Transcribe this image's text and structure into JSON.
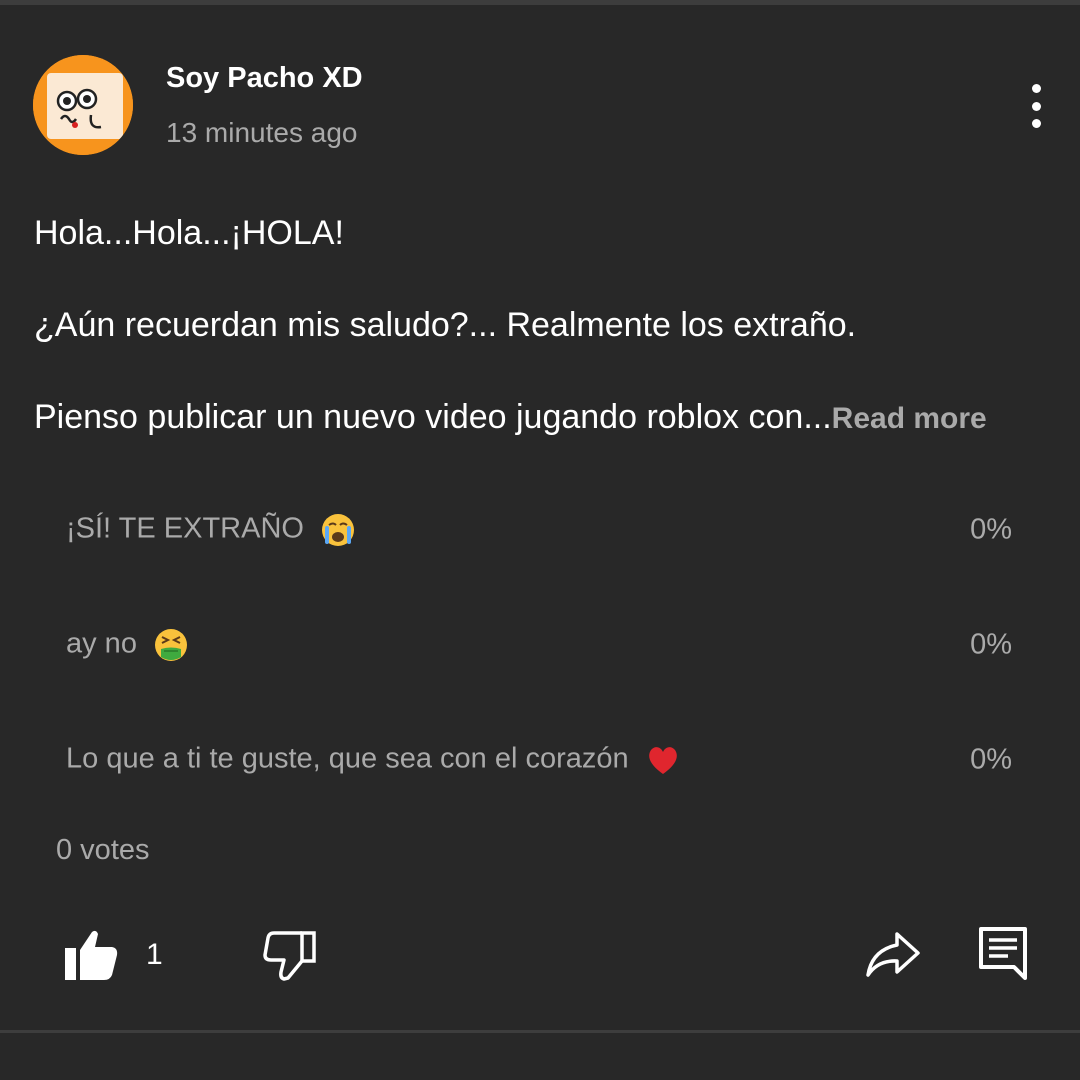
{
  "post": {
    "channel_name": "Soy Pacho XD",
    "time": "13 minutes ago",
    "lines": [
      "Hola...Hola...¡HOLA!",
      "¿Aún recuerdan mis saludo?... Realmente los extraño.",
      "Pienso publicar un nuevo video jugando roblox con..."
    ],
    "read_more": "Read more"
  },
  "poll": {
    "options": [
      {
        "text": "¡SÍ! TE EXTRAÑO",
        "emoji": "crying-face-icon",
        "percent": "0%"
      },
      {
        "text": "ay no",
        "emoji": "vomiting-face-icon",
        "percent": "0%"
      },
      {
        "text": "Lo que a ti te guste, que sea con el corazón",
        "emoji": "red-heart-icon",
        "percent": "0%"
      }
    ],
    "votes": "0 votes"
  },
  "actions": {
    "like_count": "1",
    "icons": [
      "thumbs-up-icon",
      "thumbs-down-icon",
      "share-icon",
      "comment-icon",
      "more-vert-icon"
    ]
  },
  "colors": {
    "background": "#282828",
    "primary_text": "#ffffff",
    "secondary_text": "#aaaaaa",
    "avatar_orange": "#f7941d"
  }
}
